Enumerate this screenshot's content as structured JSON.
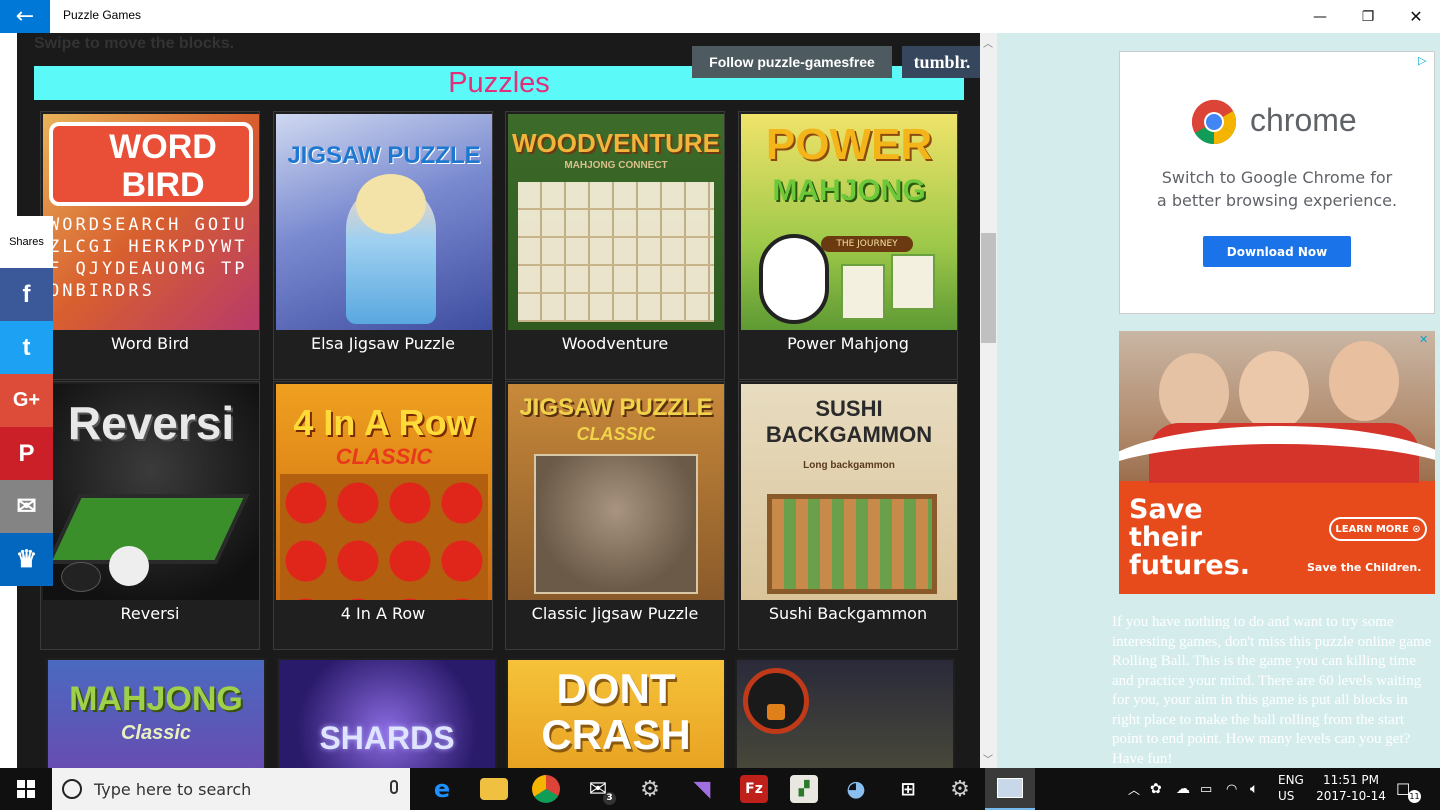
{
  "window": {
    "title": "Puzzle Games",
    "back_icon": "←",
    "minimize_icon": "—",
    "restore_icon": "❐",
    "close_icon": "✕"
  },
  "page": {
    "swipe_text": "Swipe to move the blocks.",
    "follow_label": "Follow puzzle-gamesfree",
    "tumblr_label": "tumblr.",
    "section_title": "Puzzles"
  },
  "games": [
    {
      "label": "Word Bird"
    },
    {
      "label": "Elsa Jigsaw Puzzle"
    },
    {
      "label": "Woodventure"
    },
    {
      "label": "Power Mahjong"
    },
    {
      "label": "Reversi"
    },
    {
      "label": "4 In A Row"
    },
    {
      "label": "Classic Jigsaw Puzzle"
    },
    {
      "label": "Sushi Backgammon"
    }
  ],
  "thumb_text": {
    "word_bird": "WORD BIRD",
    "word_bird_grid": "WORDSEARCH GOIUZLCGI HERKPDYWTF QJYDEAUOMG TPONBIRDRS",
    "elsa": "JIGSAW PUZZLE",
    "woodventure": "WOODVENTURE",
    "woodventure_sub": "MAHJONG CONNECT",
    "power": "POWER",
    "mahjong": "MAHJONG",
    "the_journey": "THE JOURNEY",
    "reversi": "Reversi",
    "four_row": "4 In A Row",
    "classic": "CLASSIC",
    "jigsaw": "JIGSAW PUZZLE",
    "sushi": "SUSHI BACKGAMMON",
    "sushi_sub": "Long backgammon",
    "mahjong_classic": "MAHJONG",
    "mahjong_classic_sub": "Classic",
    "shards": "SHARDS",
    "dont": "DONT",
    "crash": "CRASH"
  },
  "share": {
    "label": "Shares",
    "facebook": "f",
    "twitter": "t",
    "googleplus": "G+",
    "pinterest": "P",
    "email": "✉",
    "sumo": "♛"
  },
  "ads": {
    "chrome_word": "chrome",
    "chrome_text_line1": "Switch to Google Chrome for",
    "chrome_text_line2": "a better browsing experience.",
    "download_label": "Download Now",
    "save_line1": "Save",
    "save_line2": "their",
    "save_line3": "futures.",
    "learn_more": "LEARN MORE ⊙",
    "save_children": "Save the Children."
  },
  "description": "If you have nothing to do and want to try some interesting games, don't miss this puzzle online game Rolling Ball. This is the game you can killing time and practice your mind. There are 60 levels waiting for you, your aim in this game is put all blocks in right place to make the ball rolling from the start point to end point. How many levels can you get? Have fun!",
  "taskbar": {
    "search_placeholder": "Type here to search",
    "lang_line1": "ENG",
    "lang_line2": "US",
    "time": "11:51 PM",
    "date": "2017-10-14",
    "notification_count": "11",
    "mail_badge": "3"
  }
}
